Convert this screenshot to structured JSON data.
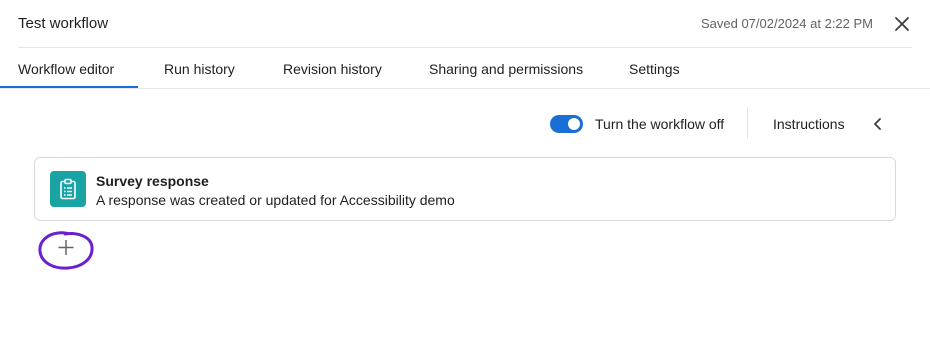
{
  "header": {
    "title": "Test workflow",
    "saved_status": "Saved 07/02/2024 at 2:22 PM",
    "close_icon": "close-icon"
  },
  "tabs": [
    {
      "label": "Workflow editor",
      "active": true
    },
    {
      "label": "Run history",
      "active": false
    },
    {
      "label": "Revision history",
      "active": false
    },
    {
      "label": "Sharing and permissions",
      "active": false
    },
    {
      "label": "Settings",
      "active": false
    }
  ],
  "toolbar": {
    "toggle_on": true,
    "toggle_label": "Turn the workflow off",
    "instructions_label": "Instructions",
    "collapse_icon": "chevron-left-icon"
  },
  "trigger_card": {
    "icon": "clipboard-icon",
    "title": "Survey response",
    "description": "A response was created or updated for Accessibility demo"
  },
  "add_step": {
    "icon": "plus-icon",
    "annotation_color": "#6a1fd0"
  },
  "colors": {
    "accent": "#1a6fd6",
    "card_icon_bg": "#19a3a3"
  }
}
